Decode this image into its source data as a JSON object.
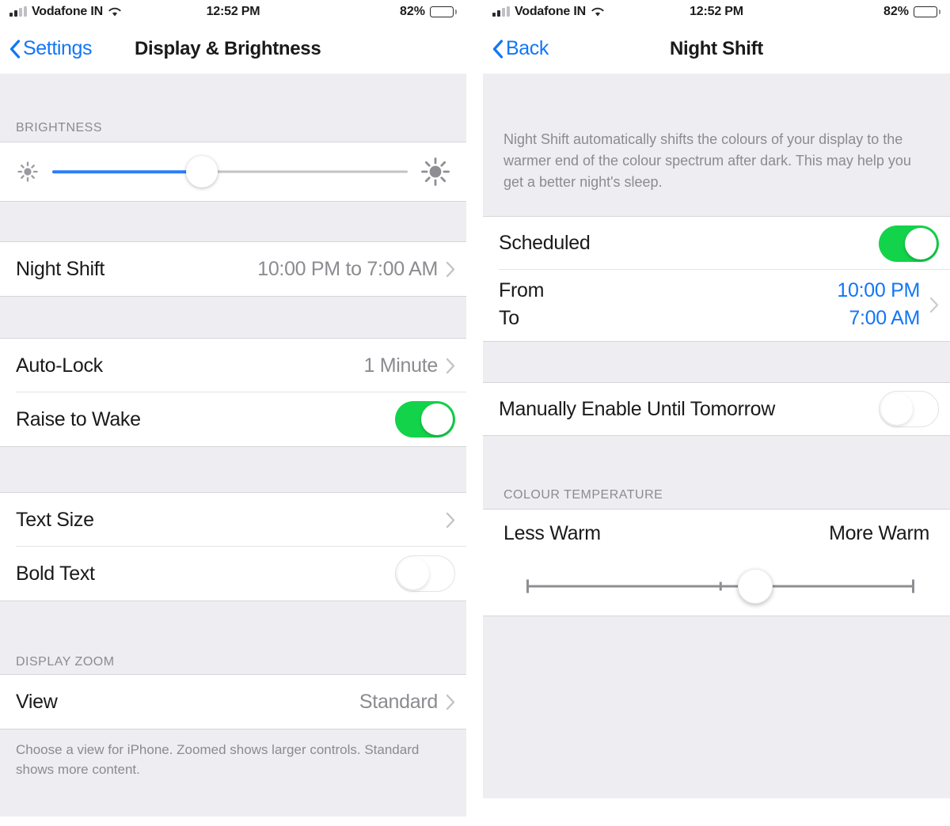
{
  "status_bar": {
    "carrier": "Vodafone IN",
    "time": "12:52 PM",
    "battery_percent": "82%",
    "signal_bars_filled": 2,
    "signal_bars_total": 4,
    "wifi_icon": "wifi-icon",
    "battery_icon": "battery-icon",
    "battery_level": 82
  },
  "colors": {
    "accent_blue": "#1276f8",
    "toggle_on_green": "#13d34a",
    "slider_blue": "#2b7dfa",
    "group_background": "#eeeef2",
    "row_background": "#ffffff",
    "secondary_text": "#8b8b90",
    "primary_text": "#1a1a1a"
  },
  "left_screen": {
    "nav": {
      "back_label": "Settings",
      "back_icon": "chevron-left-icon",
      "title": "Display & Brightness"
    },
    "brightness": {
      "section_header": "BRIGHTNESS",
      "low_icon": "sun-small-icon",
      "high_icon": "sun-large-icon",
      "value_percent": 42
    },
    "night_shift": {
      "label": "Night Shift",
      "value": "10:00 PM to 7:00 AM",
      "chevron_icon": "chevron-right-icon"
    },
    "lock_group": [
      {
        "label": "Auto-Lock",
        "value": "1 Minute",
        "type": "disclosure",
        "chevron_icon": "chevron-right-icon"
      },
      {
        "label": "Raise to Wake",
        "value": "",
        "type": "toggle",
        "toggle_on": true
      }
    ],
    "text_group": [
      {
        "label": "Text Size",
        "value": "",
        "type": "disclosure",
        "chevron_icon": "chevron-right-icon"
      },
      {
        "label": "Bold Text",
        "value": "",
        "type": "toggle",
        "toggle_on": false
      }
    ],
    "display_zoom": {
      "section_header": "DISPLAY ZOOM",
      "view_label": "View",
      "view_value": "Standard",
      "chevron_icon": "chevron-right-icon",
      "footer": "Choose a view for iPhone. Zoomed shows larger controls. Standard shows more content."
    }
  },
  "right_screen": {
    "nav": {
      "back_label": "Back",
      "back_icon": "chevron-left-icon",
      "title": "Night Shift"
    },
    "description": "Night Shift automatically shifts the colours of your display to the warmer end of the colour spectrum after dark. This may help you get a better night's sleep.",
    "scheduled": {
      "label": "Scheduled",
      "toggle_on": true
    },
    "schedule_times": {
      "from_label": "From",
      "from_value": "10:00 PM",
      "to_label": "To",
      "to_value": "7:00 AM",
      "chevron_icon": "chevron-right-icon"
    },
    "manual": {
      "label": "Manually Enable Until Tomorrow",
      "toggle_on": false
    },
    "colour_temperature": {
      "section_header": "COLOUR TEMPERATURE",
      "left_label": "Less Warm",
      "right_label": "More Warm",
      "value_percent": 59,
      "tick_percent": 50
    }
  }
}
